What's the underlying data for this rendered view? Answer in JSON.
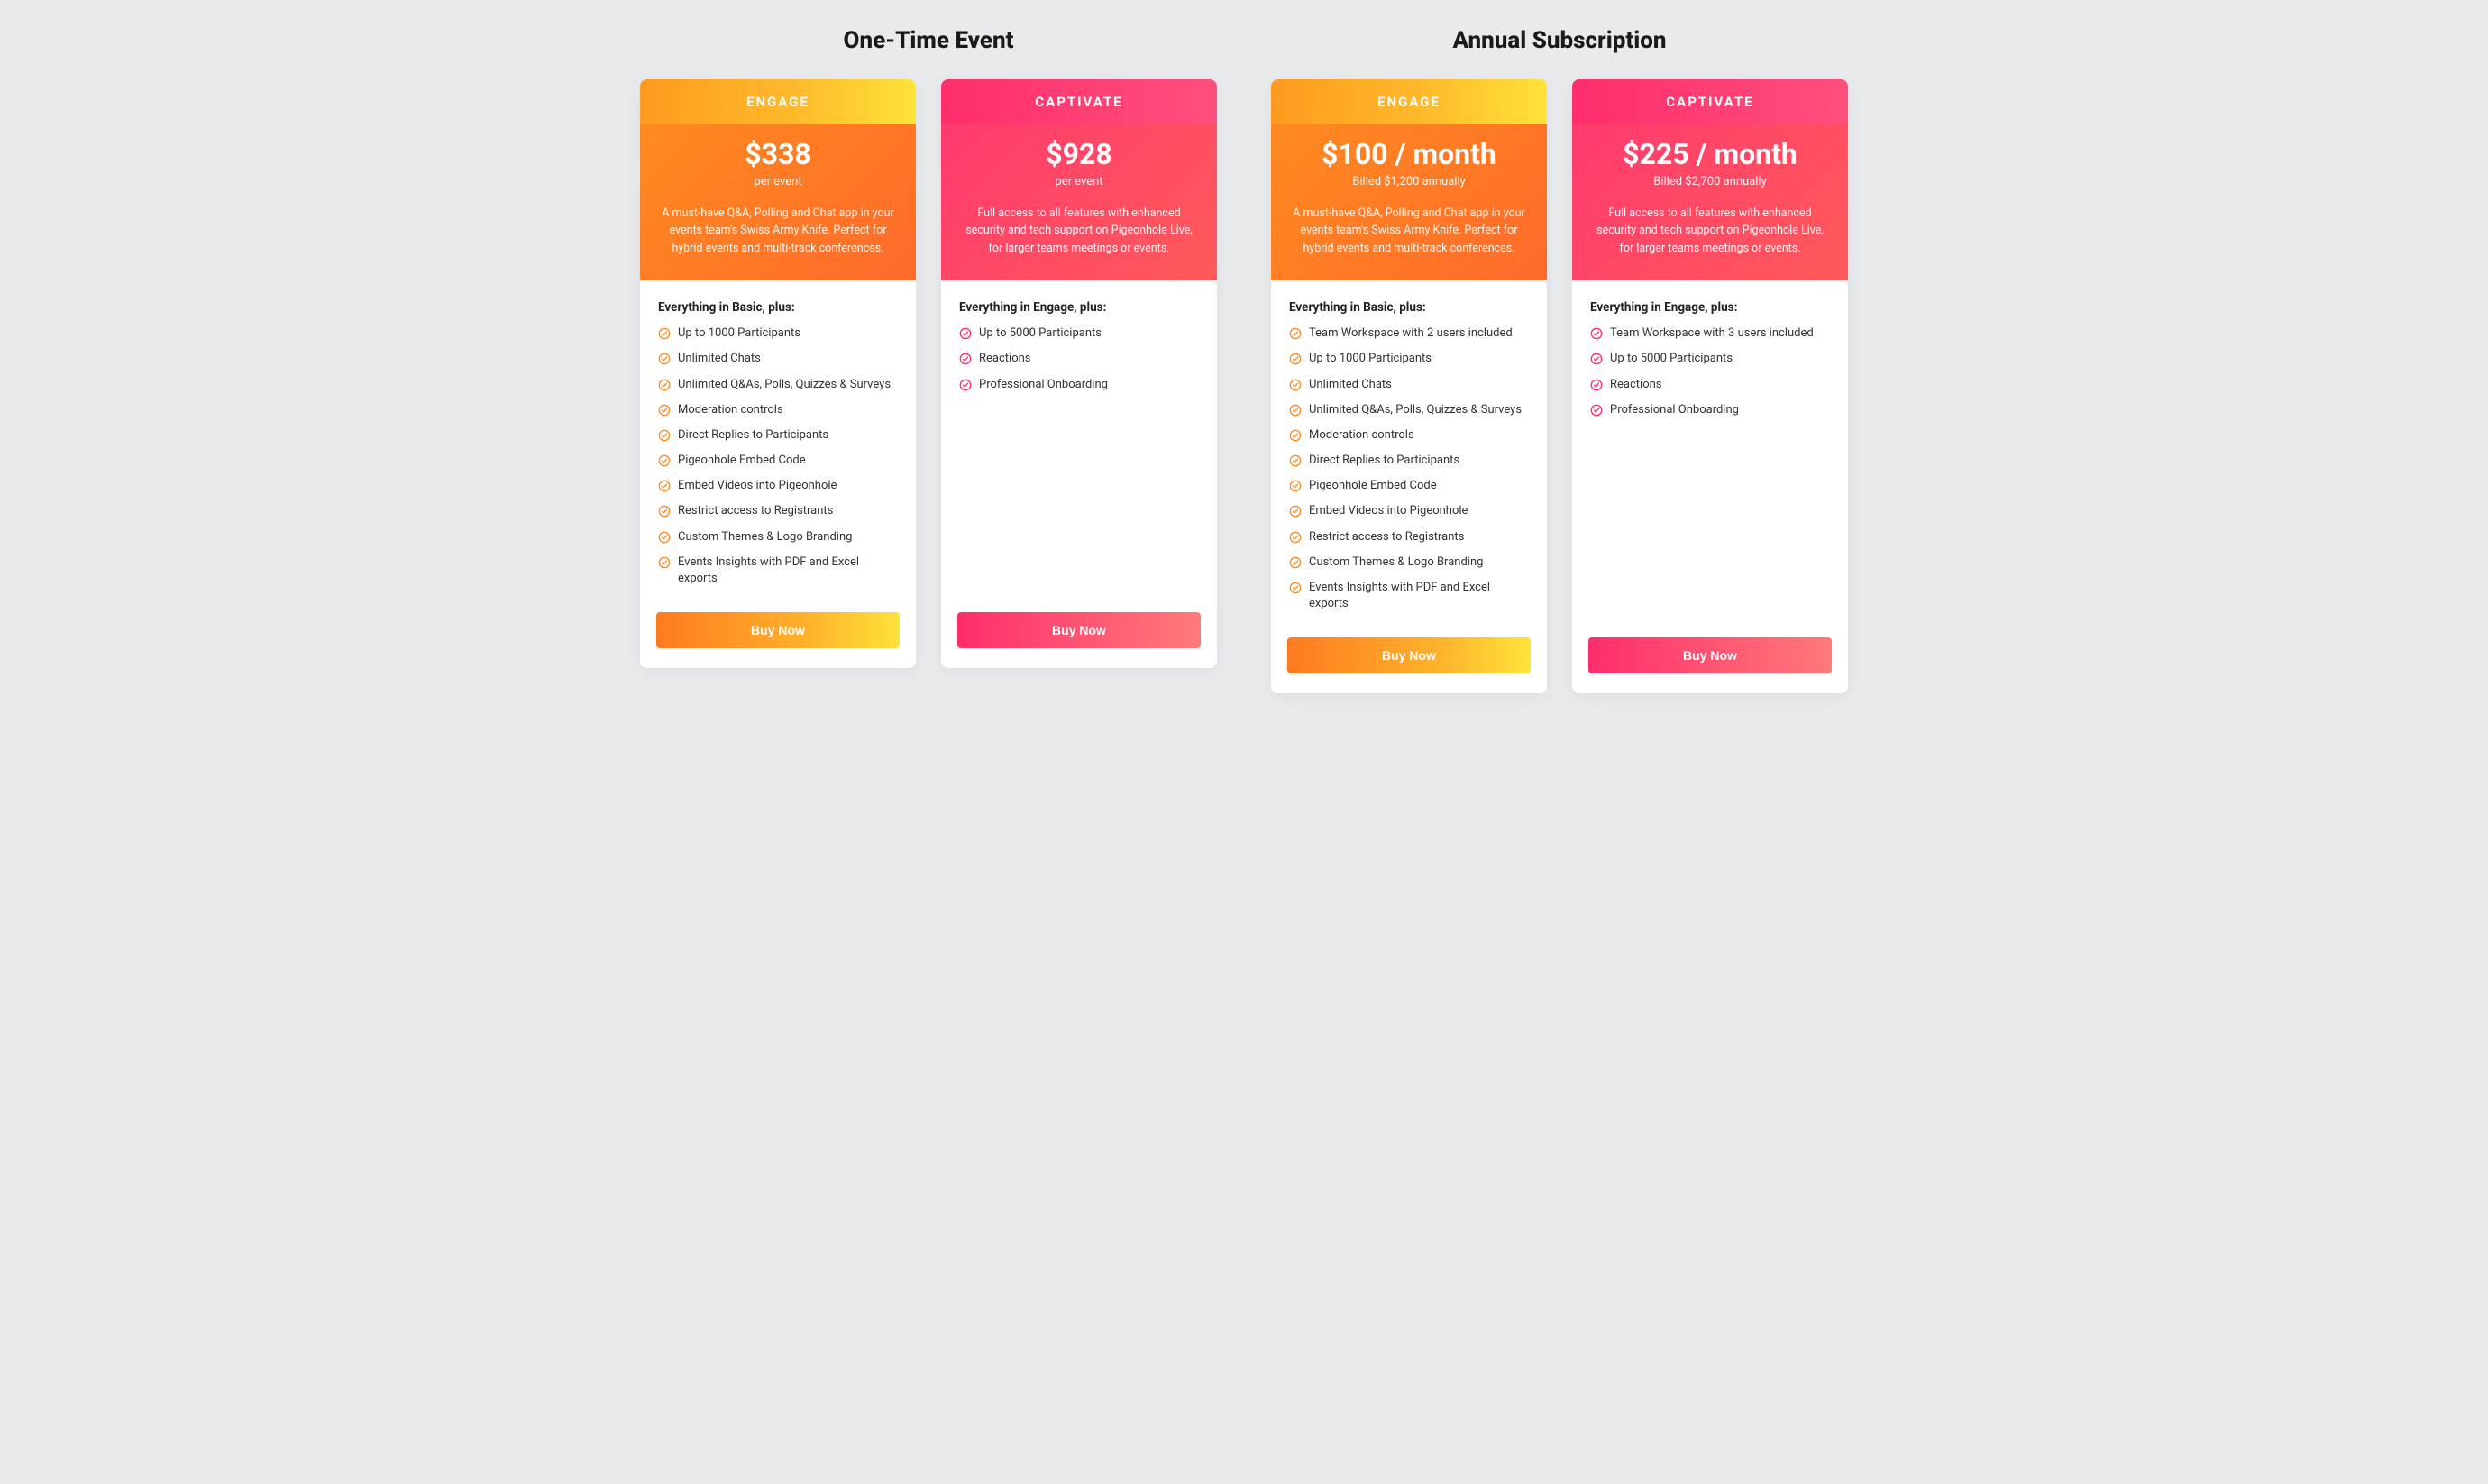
{
  "sections": [
    {
      "title": "One-Time Event",
      "plans": [
        {
          "variant": "engage",
          "name": "ENGAGE",
          "price": "$338",
          "billing": "per event",
          "desc": "A must-have Q&A, Polling and Chat app in your events team's Swiss Army Knife. Perfect for hybrid events and multi-track conferences.",
          "feat_title": "Everything in Basic, plus:",
          "features": [
            "Up to 1000 Participants",
            "Unlimited Chats",
            "Unlimited Q&As, Polls, Quizzes & Surveys",
            "Moderation controls",
            "Direct Replies to Participants",
            "Pigeonhole Embed Code",
            "Embed Videos into Pigeonhole",
            "Restrict access to Registrants",
            "Custom Themes & Logo Branding",
            "Events Insights with PDF and Excel exports"
          ],
          "cta": "Buy Now"
        },
        {
          "variant": "captivate",
          "name": "CAPTIVATE",
          "price": "$928",
          "billing": "per event",
          "desc": "Full access to all features with enhanced security and tech support on Pigeonhole Live, for larger teams meetings or events.",
          "feat_title": "Everything in Engage, plus:",
          "features": [
            "Up to 5000 Participants",
            "Reactions",
            "Professional Onboarding"
          ],
          "cta": "Buy Now"
        }
      ]
    },
    {
      "title": "Annual Subscription",
      "plans": [
        {
          "variant": "engage",
          "name": "ENGAGE",
          "price": "$100 / month",
          "billing": "Billed $1,200 annually",
          "desc": "A must-have Q&A, Polling and Chat app in your events team's Swiss Army Knife. Perfect for hybrid events and multi-track conferences.",
          "feat_title": "Everything in Basic, plus:",
          "features": [
            "Team Workspace with 2 users included",
            "Up to 1000 Participants",
            "Unlimited Chats",
            "Unlimited Q&As, Polls, Quizzes & Surveys",
            "Moderation controls",
            "Direct Replies to Participants",
            "Pigeonhole Embed Code",
            "Embed Videos into Pigeonhole",
            "Restrict access to Registrants",
            "Custom Themes & Logo Branding",
            "Events Insights with PDF and Excel exports"
          ],
          "cta": "Buy Now"
        },
        {
          "variant": "captivate",
          "name": "CAPTIVATE",
          "price": "$225 / month",
          "billing": "Billed $2,700 annually",
          "desc": "Full access to all features with enhanced security and tech support on Pigeonhole Live, for larger teams meetings or events.",
          "feat_title": "Everything in Engage, plus:",
          "features": [
            "Team Workspace with 3 users included",
            "Up to 5000 Participants",
            "Reactions",
            "Professional Onboarding"
          ],
          "cta": "Buy Now"
        }
      ]
    }
  ]
}
